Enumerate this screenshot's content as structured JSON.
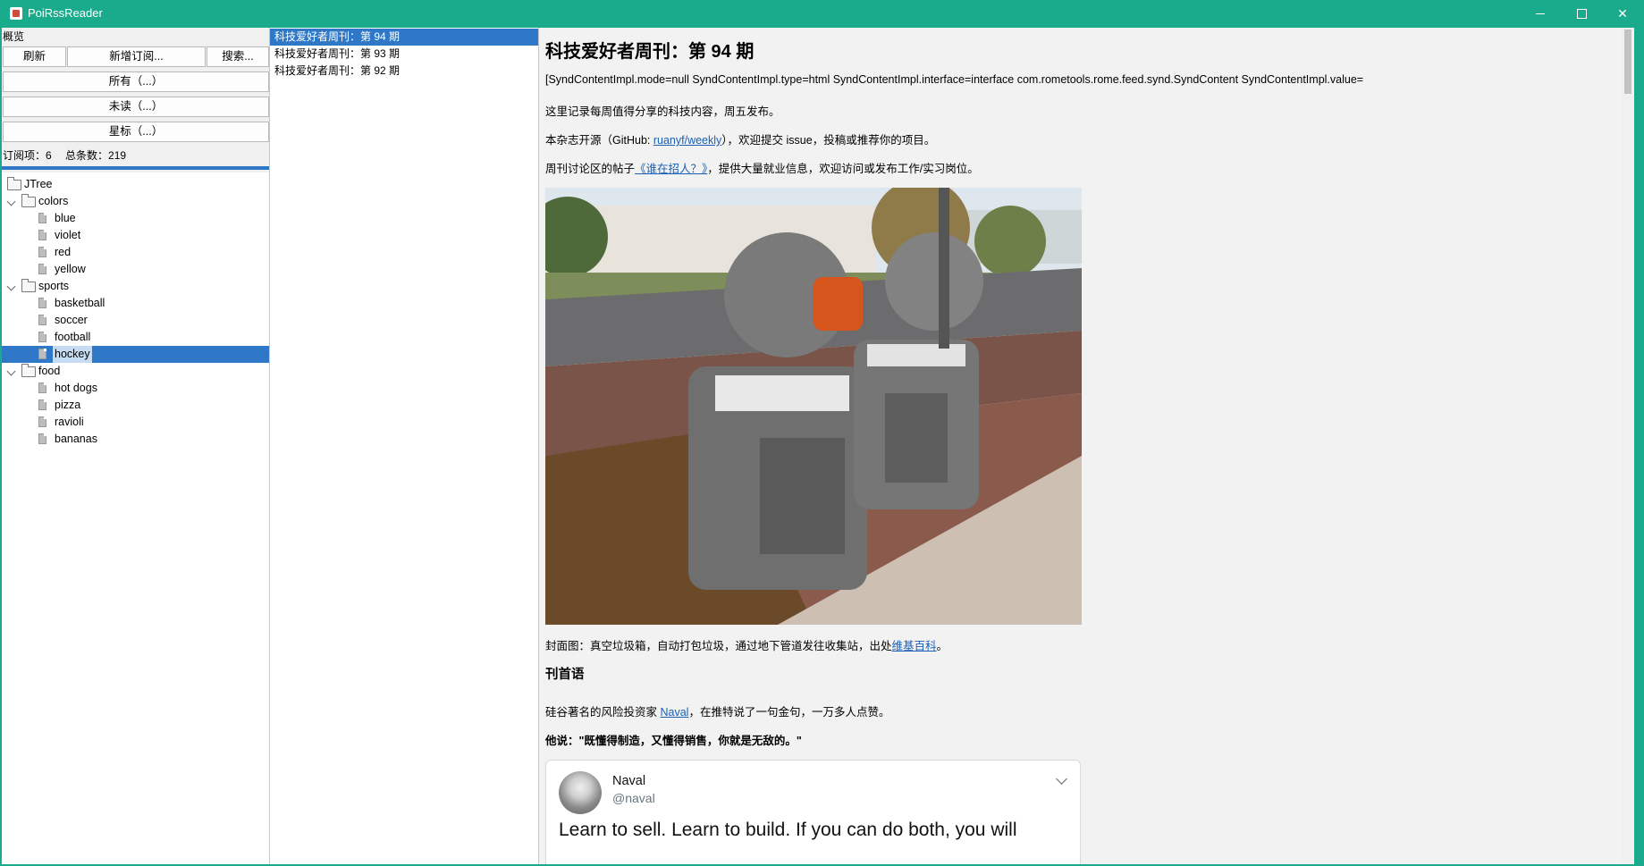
{
  "window": {
    "title": "PoiRssReader",
    "minimize": "",
    "maximize": "",
    "close": "✕"
  },
  "left": {
    "overview_label": "概览",
    "buttons": {
      "refresh": "刷新",
      "add": "新增订阅...",
      "search": "搜索...",
      "all": "所有（...）",
      "unread": "未读（...）",
      "star": "星标（...）"
    },
    "stats": {
      "subs": "订阅项：6",
      "total": "总条数：219"
    },
    "tree": {
      "root": "JTree",
      "groups": [
        {
          "label": "colors",
          "items": [
            "blue",
            "violet",
            "red",
            "yellow"
          ]
        },
        {
          "label": "sports",
          "items": [
            "basketball",
            "soccer",
            "football",
            "hockey"
          ]
        },
        {
          "label": "food",
          "items": [
            "hot dogs",
            "pizza",
            "ravioli",
            "bananas"
          ]
        }
      ],
      "selected": "hockey"
    }
  },
  "articles": [
    "科技爱好者周刊：第 94 期",
    "科技爱好者周刊：第 93 期",
    "科技爱好者周刊：第 92 期"
  ],
  "content": {
    "title": "科技爱好者周刊：第 94 期",
    "raw": "[SyndContentImpl.mode=null SyndContentImpl.type=html SyndContentImpl.interface=interface com.rometools.rome.feed.synd.SyndContent SyndContentImpl.value=",
    "p1": "这里记录每周值得分享的科技内容，周五发布。",
    "p2_pre": "本杂志开源（GitHub: ",
    "p2_link": "ruanyf/weekly",
    "p2_post": "），欢迎提交 issue，投稿或推荐你的项目。",
    "p3_pre": "周刊讨论区的帖子",
    "p3_link": "《谁在招人？》",
    "p3_post": "，提供大量就业信息，欢迎访问或发布工作/实习岗位。",
    "caption_pre": "封面图：真空垃圾箱，自动打包垃圾，通过地下管道发往收集站，出处",
    "caption_link": "维基百科",
    "caption_post": "。",
    "h_preface": "刊首语",
    "p4_pre": "硅谷著名的风险投资家 ",
    "p4_link": "Naval",
    "p4_post": "，在推特说了一句金句，一万多人点赞。",
    "p5": "他说：\"既懂得制造，又懂得销售，你就是无敌的。\"",
    "tweet": {
      "name": "Naval",
      "handle": "@naval",
      "text": "Learn to sell. Learn to build. If you can do both, you will"
    }
  }
}
